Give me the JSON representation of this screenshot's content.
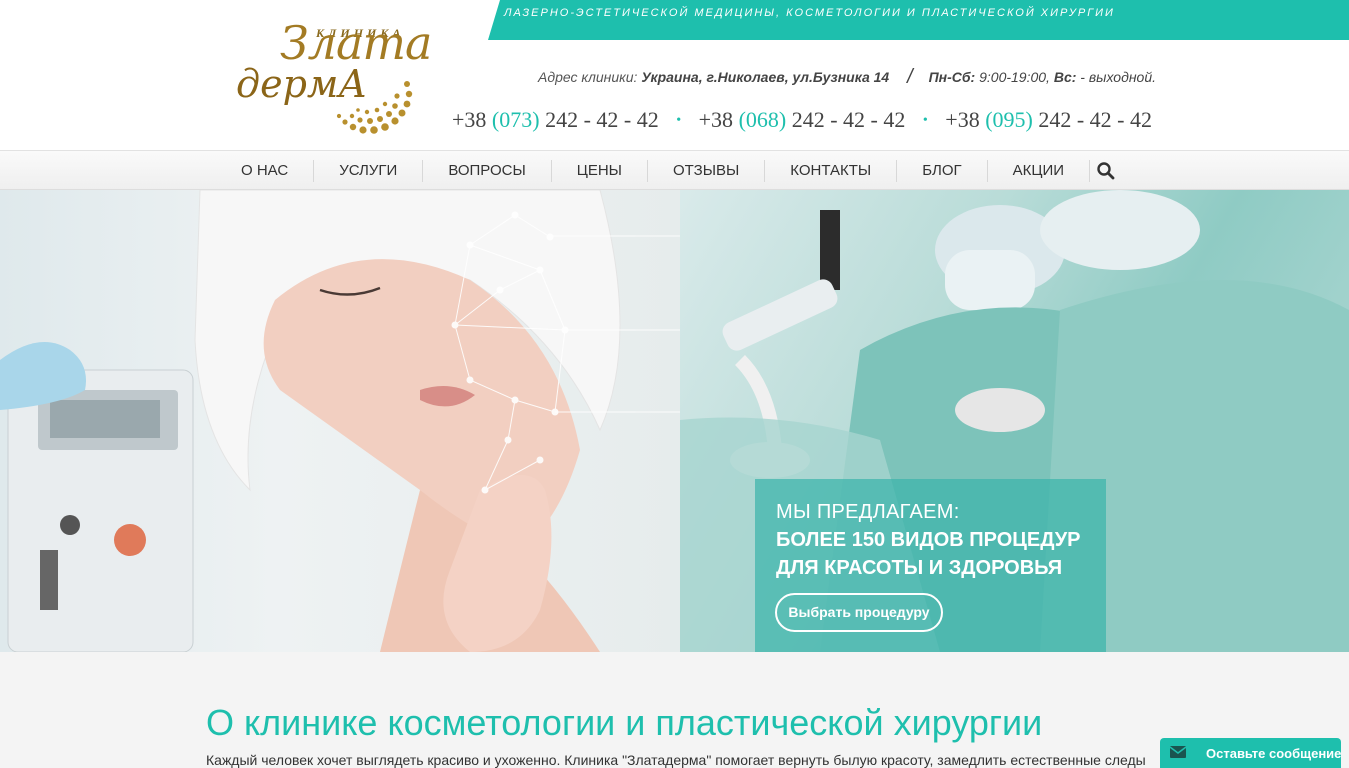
{
  "logo": {
    "small": "КЛИНИКА",
    "line1": "Злата",
    "line2": "дермА"
  },
  "header": {
    "tagline": "ЛАЗЕРНО-ЭСТЕТИЧЕСКОЙ МЕДИЦИНЫ, КОСМЕТОЛОГИИ И ПЛАСТИЧЕСКОЙ ХИРУРГИИ",
    "address_label": "Адрес клиники:",
    "address_value": "Украина, г.Николаев, ул.Бузника 14",
    "slash": "/",
    "hours_label": "Пн-Сб:",
    "hours_value": "9:00-19:00,",
    "sunday_label": "Вс:",
    "sunday_value": "- выходной.",
    "phones": [
      {
        "prefix": "+38",
        "code": "(073)",
        "number": "242 - 42 - 42"
      },
      {
        "prefix": "+38",
        "code": "(068)",
        "number": "242 - 42 - 42"
      },
      {
        "prefix": "+38",
        "code": "(095)",
        "number": "242 - 42 - 42"
      }
    ],
    "separator": "•"
  },
  "nav": {
    "items": [
      "О НАС",
      "УСЛУГИ",
      "ВОПРОСЫ",
      "ЦЕНЫ",
      "ОТЗЫВЫ",
      "КОНТАКТЫ",
      "БЛОГ",
      "АКЦИИ"
    ],
    "search_icon": "search-icon"
  },
  "hero": {
    "line1": "МЫ ПРЕДЛАГАЕМ:",
    "line2": "БОЛЕЕ 150 ВИДОВ ПРОЦЕДУР",
    "line3": "ДЛЯ КРАСОТЫ И ЗДОРОВЬЯ",
    "button": "Выбрать процедуру"
  },
  "about": {
    "title": "О клинике косметологии и пластической хирургии",
    "text": "Каждый человек хочет выглядеть красиво и ухоженно. Клиника \"Златадерма\" помогает вернуть былую красоту, замедлить естественные следы"
  },
  "chat": {
    "label": "Оставьте сообщение",
    "icon": "envelope-icon"
  },
  "colors": {
    "accent": "#1ebfad",
    "gold": "#a37b24"
  }
}
